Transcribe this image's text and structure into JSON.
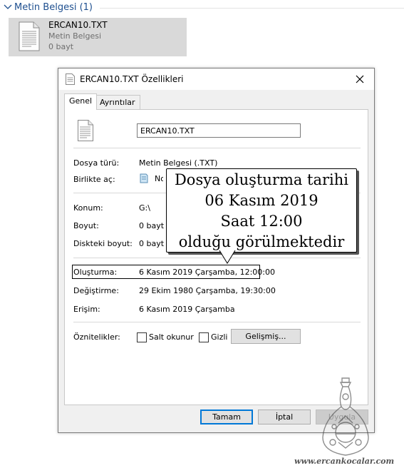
{
  "group": {
    "title": "Metin Belgesi (1)",
    "icon": "chevron-down-icon"
  },
  "file_tile": {
    "name": "ERCAN10.TXT",
    "type": "Metin Belgesi",
    "size": "0 bayt",
    "icon": "text-document-icon"
  },
  "dialog": {
    "title": "ERCAN10.TXT Özellikleri",
    "close_icon": "close-icon",
    "tabs": [
      {
        "label": "Genel",
        "selected": true
      },
      {
        "label": "Ayrıntılar",
        "selected": false
      }
    ],
    "file_name_value": "ERCAN10.TXT",
    "rows": {
      "file_type": {
        "label": "Dosya türü:",
        "value": "Metin Belgesi (.TXT)"
      },
      "open_with": {
        "label": "Birlikte aç:",
        "value": "No"
      },
      "location": {
        "label": "Konum:",
        "value": "G:\\"
      },
      "size": {
        "label": "Boyut:",
        "value": "0 bayt"
      },
      "size_on_disk": {
        "label": "Diskteki boyut:",
        "value": "0 bayt"
      },
      "created": {
        "label": "Oluşturma:",
        "value": "6 Kasım 2019 Çarşamba, 12:00:00"
      },
      "modified": {
        "label": "Değiştirme:",
        "value": "29 Ekim 1980 Çarşamba, 19:30:00"
      },
      "accessed": {
        "label": "Erişim:",
        "value": "6 Kasım 2019 Çarşamba"
      }
    },
    "attributes": {
      "label": "Öznitelikler:",
      "readonly": {
        "label": "Salt okunur",
        "checked": false
      },
      "hidden": {
        "label": "Gizli",
        "checked": false
      },
      "advanced_button": "Gelişmiş..."
    },
    "buttons": {
      "ok": "Tamam",
      "cancel": "İptal",
      "apply": "Uygula"
    }
  },
  "callout": {
    "lines": [
      "Dosya oluşturma tarihi",
      "06 Kasım 2019",
      "Saat 12:00",
      "olduğu görülmektedir"
    ]
  },
  "watermark": {
    "text": "www.ercankocalar.com"
  },
  "colors": {
    "accent": "#0078d7",
    "group_title": "#1e4f8f",
    "tile_bg": "#d9d9d9",
    "dialog_bg": "#f0f0f0"
  }
}
